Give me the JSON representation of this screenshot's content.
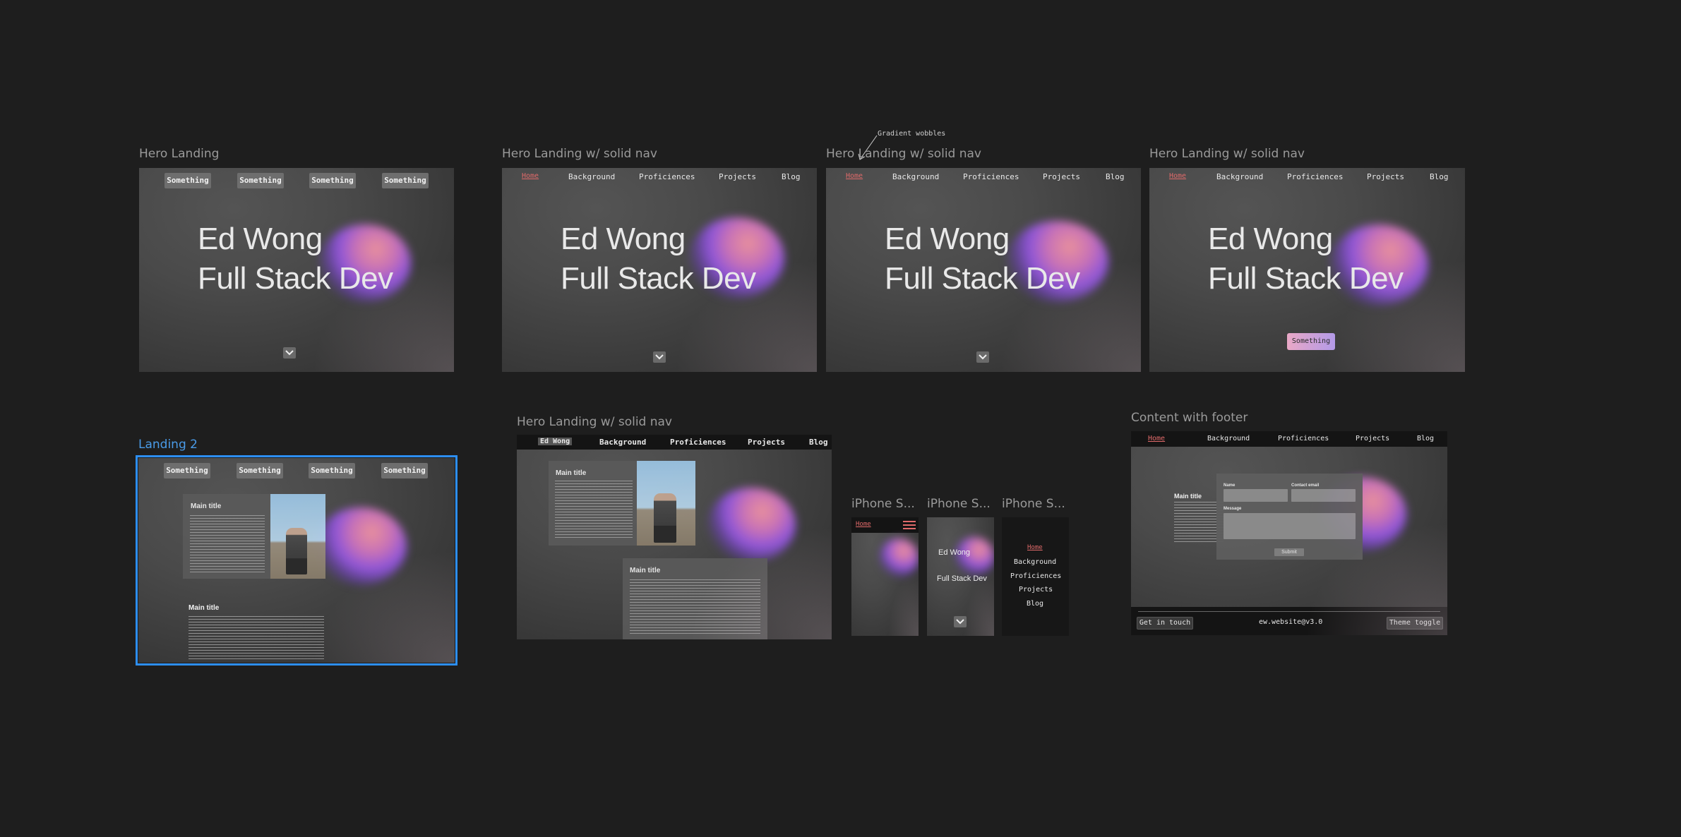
{
  "canvas": {
    "background": "#1e1e1e",
    "accent": "#e06a6a",
    "selection": "#2d8ef0"
  },
  "annotation": {
    "text": "Gradient wobbles"
  },
  "frames": {
    "hero_landing": {
      "label": "Hero Landing",
      "buttons": [
        "Something",
        "Something",
        "Something",
        "Something"
      ],
      "name": "Ed Wong",
      "title": "Full Stack Dev"
    },
    "hero_solid_nav_1": {
      "label": "Hero Landing w/ solid nav",
      "nav": [
        "Home",
        "Background",
        "Proficiences",
        "Projects",
        "Blog"
      ],
      "name": "Ed Wong",
      "title": "Full Stack Dev"
    },
    "hero_solid_nav_2": {
      "label": "Hero Landing w/ solid nav",
      "nav": [
        "Home",
        "Background",
        "Proficiences",
        "Projects",
        "Blog"
      ],
      "name": "Ed Wong",
      "title": "Full Stack Dev"
    },
    "hero_solid_nav_3": {
      "label": "Hero Landing w/ solid nav",
      "nav": [
        "Home",
        "Background",
        "Proficiences",
        "Projects",
        "Blog"
      ],
      "name": "Ed Wong",
      "title": "Full Stack Dev",
      "cta": "Something"
    },
    "landing_2": {
      "label": "Landing 2",
      "buttons": [
        "Something",
        "Something",
        "Something",
        "Something"
      ],
      "card1_title": "Main title",
      "card2_title": "Main title"
    },
    "hero_solid_nav_4": {
      "label": "Hero Landing w/ solid nav",
      "nav": [
        "Ed Wong",
        "Background",
        "Proficiences",
        "Projects",
        "Blog"
      ],
      "card1_title": "Main title",
      "card2_title": "Main title"
    },
    "iphone_1": {
      "label": "iPhone S...",
      "nav_home": "Home"
    },
    "iphone_2": {
      "label": "iPhone S...",
      "name": "Ed Wong",
      "title": "Full Stack Dev"
    },
    "iphone_3": {
      "label": "iPhone S...",
      "menu": [
        "Home",
        "Background",
        "Proficiences",
        "Projects",
        "Blog"
      ]
    },
    "content_footer": {
      "label": "Content with footer",
      "nav": [
        "Home",
        "Background",
        "Proficiences",
        "Projects",
        "Blog"
      ],
      "card_title": "Main title",
      "form": {
        "name_label": "Name",
        "email_label": "Contact email",
        "message_label": "Message",
        "submit": "Submit"
      },
      "footer": {
        "get_in_touch": "Get in touch",
        "version": "ew.website@v3.0",
        "theme_toggle": "Theme toggle"
      }
    }
  }
}
